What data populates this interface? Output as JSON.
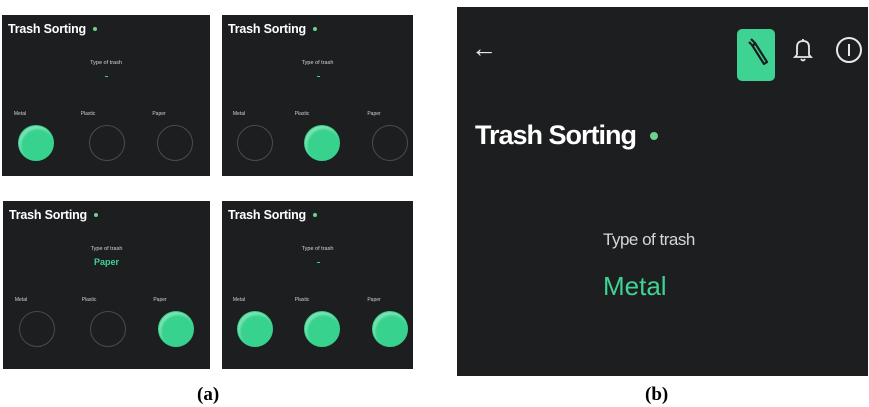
{
  "colors": {
    "panel_bg": "#1d1e20",
    "accent": "#3fd393",
    "dot": "#6fd18f"
  },
  "figure_a": {
    "panels": [
      {
        "title": "Trash Sorting",
        "type_label": "Type of trash",
        "value": "",
        "options": [
          {
            "label": "Metal",
            "active": true
          },
          {
            "label": "Plastic",
            "active": false
          },
          {
            "label": "Paper",
            "active": false
          }
        ]
      },
      {
        "title": "Trash Sorting",
        "type_label": "Type of trash",
        "value": "",
        "options": [
          {
            "label": "Metal",
            "active": false
          },
          {
            "label": "Plastic",
            "active": true
          },
          {
            "label": "Paper",
            "active": false
          }
        ]
      },
      {
        "title": "Trash Sorting",
        "type_label": "Type of trash",
        "value": "Paper",
        "options": [
          {
            "label": "Metal",
            "active": false
          },
          {
            "label": "Plastic",
            "active": false
          },
          {
            "label": "Paper",
            "active": true
          }
        ]
      },
      {
        "title": "Trash Sorting",
        "type_label": "Type of trash",
        "value": "",
        "options": [
          {
            "label": "Metal",
            "active": true
          },
          {
            "label": "Plastic",
            "active": true
          },
          {
            "label": "Paper",
            "active": true
          }
        ]
      }
    ],
    "caption": "(a)"
  },
  "figure_b": {
    "back_icon": "arrow-left-icon",
    "wrench_icon": "wrench-icon",
    "bell_icon": "bell-icon",
    "info_icon": "info-icon",
    "title": "Trash Sorting",
    "type_label": "Type of trash",
    "value": "Metal",
    "caption": "(b)"
  }
}
